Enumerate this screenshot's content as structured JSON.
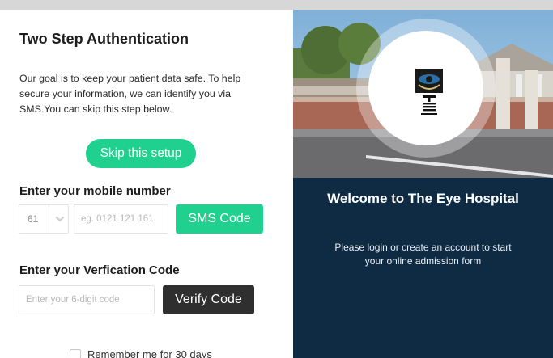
{
  "left": {
    "title": "Two Step Authentication",
    "intro": "Our goal is to keep your patient data safe. To help secure your information, we can identify you via SMS.You can skip this step below.",
    "skip_label": "Skip this setup",
    "mobile_label": "Enter your mobile number",
    "country_code": "61",
    "mobile_placeholder": "eg. 0121 121 161",
    "sms_label": "SMS Code",
    "code_label": "Enter your Verfication Code",
    "code_placeholder": "Enter your 6-digit code",
    "verify_label": "Verify Code",
    "remember_label": "Remember me for 30 days"
  },
  "right": {
    "logo_text": "THE EYE HOSPITAL",
    "welcome_title": "Welcome to The Eye Hospital",
    "welcome_sub": "Please login or create an account to start your online admission form"
  },
  "colors": {
    "accent_green": "#1fd08f",
    "dark_button": "#2f2f2f",
    "panel_navy": "#0f2a43"
  },
  "icons": {
    "country_dropdown": "chevron-down-icon",
    "logo": "eye-hospital-logo"
  }
}
